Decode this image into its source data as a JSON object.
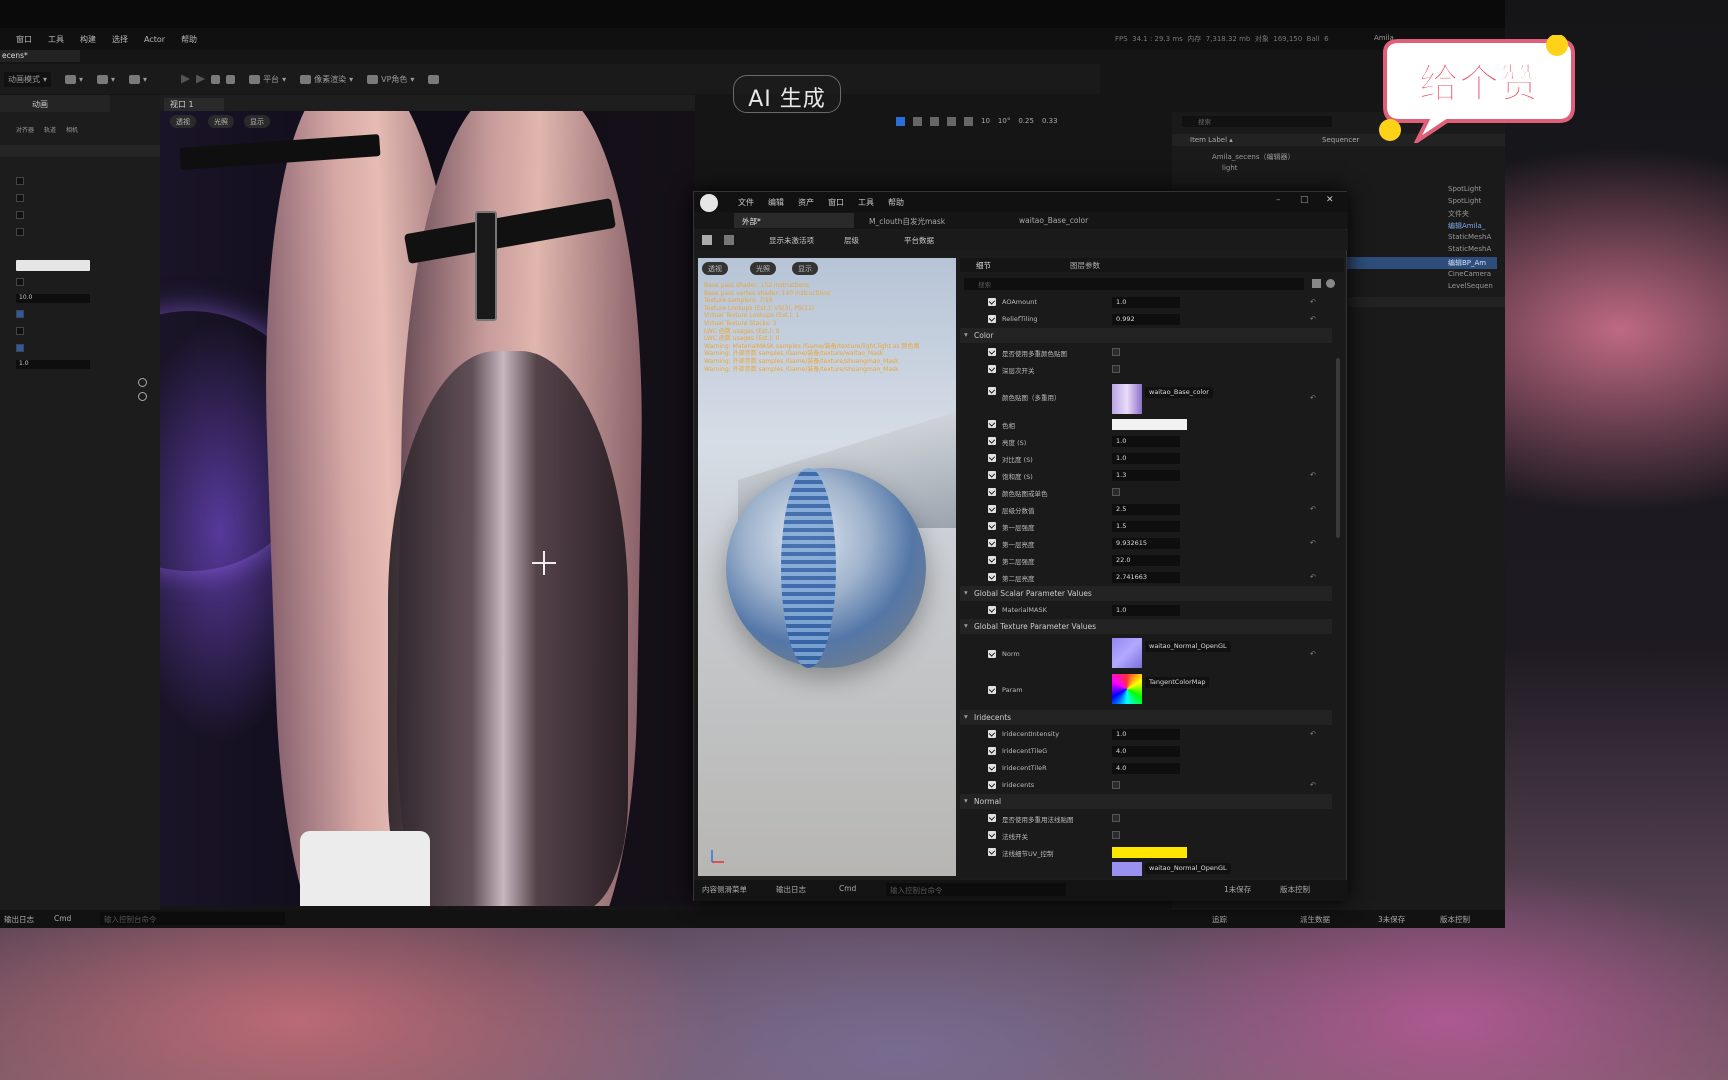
{
  "app": {
    "tab_title": "ecens*",
    "level_tab": "动画",
    "viewport_tab": "视口 1",
    "mode": "动画模式"
  },
  "menu": [
    "窗口",
    "工具",
    "构建",
    "选择",
    "Actor",
    "帮助"
  ],
  "stats": "FPS  34.1 : 29.3 ms  内存  7,318.32 mb  对象  169,150  Ball  6",
  "user": "Amila",
  "toolbar": {
    "platform": "平台",
    "quality": "像素渲染",
    "vp": "VP角色"
  },
  "left_panel": {
    "icons": [
      "对齐器",
      "轨道",
      "相机"
    ],
    "value1": "10.0",
    "value2": "1.0"
  },
  "viewport_buttons": [
    "透视",
    "光照",
    "显示"
  ],
  "viewport_toolbar": {
    "grid": "10",
    "rot": "10°",
    "scale": "0.25",
    "cam": "0.33"
  },
  "outliner": {
    "search_placeholder": "搜索",
    "col1": "Item Label ▴",
    "col2": "Sequencer",
    "rows": [
      "Amila_secens（编辑器）",
      "light",
      "SpotLight",
      "SpotLight",
      "文件夹",
      "编辑Amila_",
      "StaticMeshA",
      "StaticMeshA",
      "编辑BP_Am",
      "CineCamera",
      "LevelSequen"
    ]
  },
  "material": {
    "menu": [
      "文件",
      "编辑",
      "资产",
      "窗口",
      "工具",
      "帮助"
    ],
    "tabs": [
      "外部*",
      "M_clouth自发光mask",
      "waitao_Base_color"
    ],
    "toolbar": [
      "显示未激活项",
      "层级",
      "平台数据"
    ],
    "preview_buttons": [
      "透视",
      "光照",
      "显示"
    ],
    "preview_log": [
      "Base pass shader: 152 instructions",
      "Base pass vertex shader: 140 instructions",
      "Texture samplers: 7/16",
      "Texture Lookups (Est.): VS(3), PS(11)",
      "Virtual Texture Lookups (Est.): 1",
      "Virtual Texture Stacks: 2",
      "LWC 函数 usages (Est.): 0",
      "LWC 函数 usages (Est.): 0",
      "Warning: MaterialMASK samples /Game/装备/texture/light.light as 颜色图",
      "Warning: 外部参数 samples /Game/装备/texture/waitao_Mask",
      "Warning: 外部参数 samples /Game/装备/texture/shuangmao_Mask",
      "Warning: 外部参数 samples /Game/装备/texture/shuangmao_Mask"
    ],
    "details_tabs": [
      "细节",
      "图层参数"
    ],
    "search_placeholder": "搜索",
    "rows": {
      "aoamount": {
        "label": "AOAmount",
        "value": "1.0"
      },
      "reliefttiling": {
        "label": "ReliefTiling",
        "value": "0.992"
      },
      "section_color": "Color",
      "r1": "是否使用多重颜色贴图",
      "r2": "深层次开关",
      "basecolor": {
        "label": "颜色贴图（多重用）",
        "asset": "waitao_Base_color"
      },
      "tint": "色相",
      "brightness": {
        "label": "亮度 (S)",
        "value": "1.0"
      },
      "contrast": {
        "label": "对比度 (S)",
        "value": "1.0"
      },
      "saturation": {
        "label": "饱和度 (S)",
        "value": "1.3"
      },
      "r8": "颜色贴图或单色",
      "levels": {
        "label": "层级分数值",
        "value": "2.5"
      },
      "lay1": {
        "label": "第一层强度",
        "value": "1.5"
      },
      "lay1b": {
        "label": "第一层亮度",
        "value": "9.932615"
      },
      "lay2": {
        "label": "第二层强度",
        "value": "22.0"
      },
      "lay2b": {
        "label": "第二层亮度",
        "value": "2.741663"
      },
      "section_gsp": "Global Scalar Parameter Values",
      "materialmask": {
        "label": "MaterialMASK",
        "value": "1.0"
      },
      "section_gtp": "Global Texture Parameter Values",
      "norm": {
        "label": "Norm",
        "asset": "waitao_Normal_OpenGL"
      },
      "param": {
        "label": "Param",
        "asset": "TangentColorMap"
      },
      "section_iri": "Iridecents",
      "iri_int": {
        "label": "IridecentIntensity",
        "value": "1.0"
      },
      "iri_tile": {
        "label": "IridecentTileG",
        "value": "4.0"
      },
      "iri_tiler": {
        "label": "IridecentTileR",
        "value": "4.0"
      },
      "iri": "Iridecents",
      "section_normal": "Normal",
      "n1": "是否使用多重用法线贴图",
      "n2": "法线开关",
      "n3": "法线细节UV_控制",
      "nasset": "waitao_Normal_OpenGL"
    },
    "bottom": {
      "content": "内容侧滑菜单",
      "log": "输出日志",
      "cmd": "Cmd",
      "input_placeholder": "输入控制台命令",
      "unsaved": "1未保存",
      "source": "版本控制"
    }
  },
  "statusbar": {
    "log": "输出日志",
    "cmd": "Cmd",
    "placeholder": "输入控制台命令",
    "trace": "追踪",
    "derived": "派生数据",
    "unsaved": "3未保存",
    "source": "版本控制"
  },
  "overlay": {
    "ai": "AI 生成",
    "like": "给个赞"
  },
  "colors": {
    "ue_bg": "#151515",
    "panel": "#1c1c1c",
    "highlight": "#2e4d7a",
    "swatch_yellow": "#ffe600",
    "swatch_white": "#f2f2f2"
  }
}
